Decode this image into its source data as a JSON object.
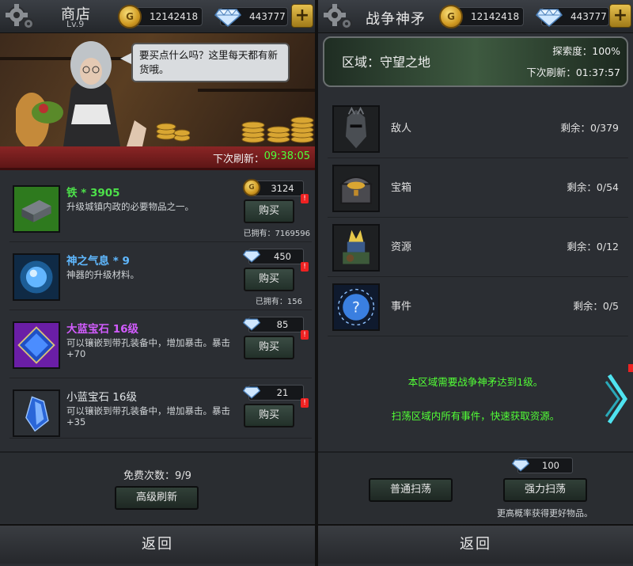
{
  "left": {
    "header": {
      "title": "商店",
      "level": "Lv.9",
      "gold": "12142418",
      "diamonds": "443777"
    },
    "banner": {
      "speech": "要买点什么吗？这里每天都有新货哦。",
      "refresh_label": "下次刷新：",
      "refresh_time": "09:38:05"
    },
    "items": [
      {
        "name": "铁 * 3905",
        "name_color": "#4de14a",
        "desc": "升级城镇内政的必要物品之一。",
        "currency": "gold-coin",
        "price": "3124",
        "buy": "购买",
        "owned": "已拥有：7169596"
      },
      {
        "name": "神之气息 * 9",
        "name_color": "#5fb8ff",
        "desc": "神器的升级材料。",
        "currency": "diamond",
        "price": "450",
        "buy": "购买",
        "owned": "已拥有：156"
      },
      {
        "name": "大蓝宝石 16级",
        "name_color": "#d35cff",
        "desc": "可以镶嵌到带孔装备中，增加暴击。暴击 +70",
        "currency": "diamond",
        "price": "85",
        "buy": "购买",
        "owned": ""
      },
      {
        "name": "小蓝宝石 16级",
        "name_color": "#dfe3e6",
        "desc": "可以镶嵌到带孔装备中，增加暴击。暴击 +35",
        "currency": "diamond",
        "price": "21",
        "buy": "购买",
        "owned": ""
      }
    ],
    "free_count": "免费次数：9/9",
    "advanced_refresh": "高级刷新",
    "back": "返回"
  },
  "right": {
    "header": {
      "title": "战争神矛",
      "gold": "12142418",
      "diamonds": "443777"
    },
    "zone": {
      "name": "区域：守望之地",
      "explore": "探索度：100%",
      "refresh": "下次刷新：01:37:57"
    },
    "rows": [
      {
        "name": "敌人",
        "remain": "剩余：0/379",
        "icon": "knight-icon"
      },
      {
        "name": "宝箱",
        "remain": "剩余：0/54",
        "icon": "chest-icon"
      },
      {
        "name": "资源",
        "remain": "剩余：0/12",
        "icon": "crystal-resource-icon"
      },
      {
        "name": "事件",
        "remain": "剩余：0/5",
        "icon": "question-orb-icon"
      }
    ],
    "messages": [
      "本区域需要战争神矛达到1级。",
      "扫荡区域内所有事件，快速获取资源。"
    ],
    "sweep_price": "100",
    "normal_sweep": "普通扫荡",
    "power_sweep": "强力扫荡",
    "hint": "更高概率获得更好物品。",
    "back": "返回"
  }
}
